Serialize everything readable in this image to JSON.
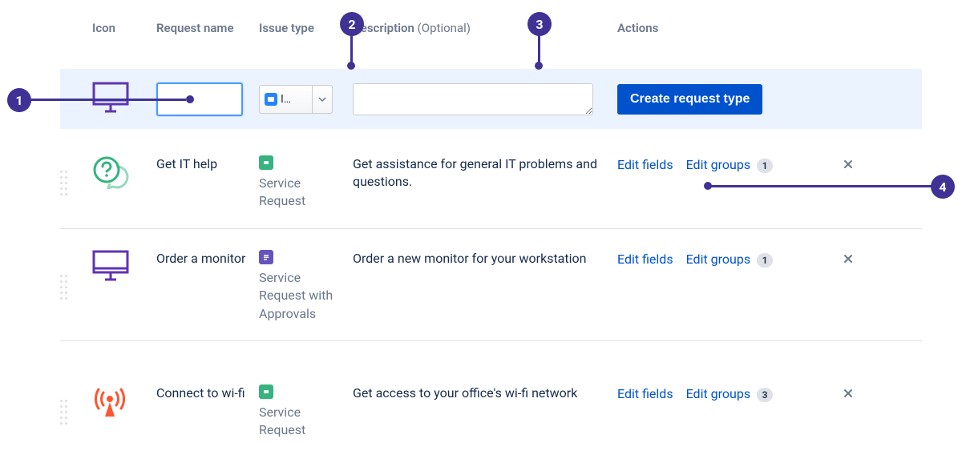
{
  "callouts": {
    "c1": "1",
    "c2": "2",
    "c3": "3",
    "c4": "4"
  },
  "headers": {
    "icon": "Icon",
    "request_name": "Request name",
    "issue_type": "Issue type",
    "description": "Description",
    "description_optional": "(Optional)",
    "actions": "Actions"
  },
  "create": {
    "issuetype_truncated": "I…",
    "create_button": "Create request type"
  },
  "actions": {
    "edit_fields": "Edit fields",
    "edit_groups": "Edit groups"
  },
  "rows": [
    {
      "name": "Get IT help",
      "issue_type": "Service Request",
      "description": "Get assistance for general IT problems and questions.",
      "groups_count": "1",
      "issue_icon": "green"
    },
    {
      "name": "Order a monitor",
      "issue_type": "Service Request with Approvals",
      "description": "Order a new monitor for your workstation",
      "groups_count": "1",
      "issue_icon": "purple"
    },
    {
      "name": "Connect to wi-fi",
      "issue_type": "Service Request",
      "description": "Get access to your office's wi-fi network",
      "groups_count": "3",
      "issue_icon": "green"
    }
  ]
}
